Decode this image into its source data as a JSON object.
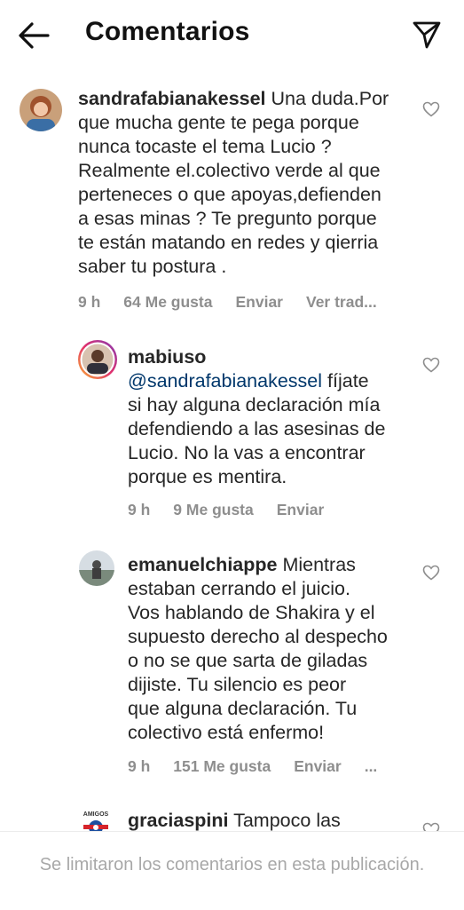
{
  "header": {
    "title": "Comentarios",
    "back_icon": "arrow-left-icon",
    "share_icon": "paper-plane-icon"
  },
  "comments": [
    {
      "username": "sandrafabianakessel",
      "text": " Una duda.Por\nque mucha gente te pega porque\nnunca tocaste el tema Lucio ?\nRealmente el.colectivo verde al que\nperteneces o que apoyas,defienden\na esas minas ? Te pregunto porque\nte están matando en redes y qierria\nsaber tu postura .",
      "time": "9 h",
      "likes": "64 Me gusta",
      "reply": "Enviar",
      "translate": "Ver trad..."
    },
    {
      "username": "mabiuso",
      "mention": "@sandrafabianakessel",
      "text": " fíjate\nsi hay alguna declaración mía\ndefendiendo a las asesinas de\nLucio. No la vas a encontrar\nporque es mentira.",
      "time": "9 h",
      "likes": "9 Me gusta",
      "reply": "Enviar"
    },
    {
      "username": "emanuelchiappe",
      "text": " Mientras\nestaban cerrando el juicio.\nVos hablando de Shakira y el\nsupuesto derecho al despecho\no no se que sarta de giladas\ndijiste. Tu silencio es peor\nque alguna declaración. Tu\ncolectivo está enfermo!",
      "time": "9 h",
      "likes": "151 Me gusta",
      "reply": "Enviar",
      "more": "..."
    },
    {
      "username": "graciaspini",
      "text": " Tampoco las",
      "avatar_label": "AMIGOS"
    }
  ],
  "footer": {
    "notice": "Se limitaron los comentarios en esta publicación."
  }
}
